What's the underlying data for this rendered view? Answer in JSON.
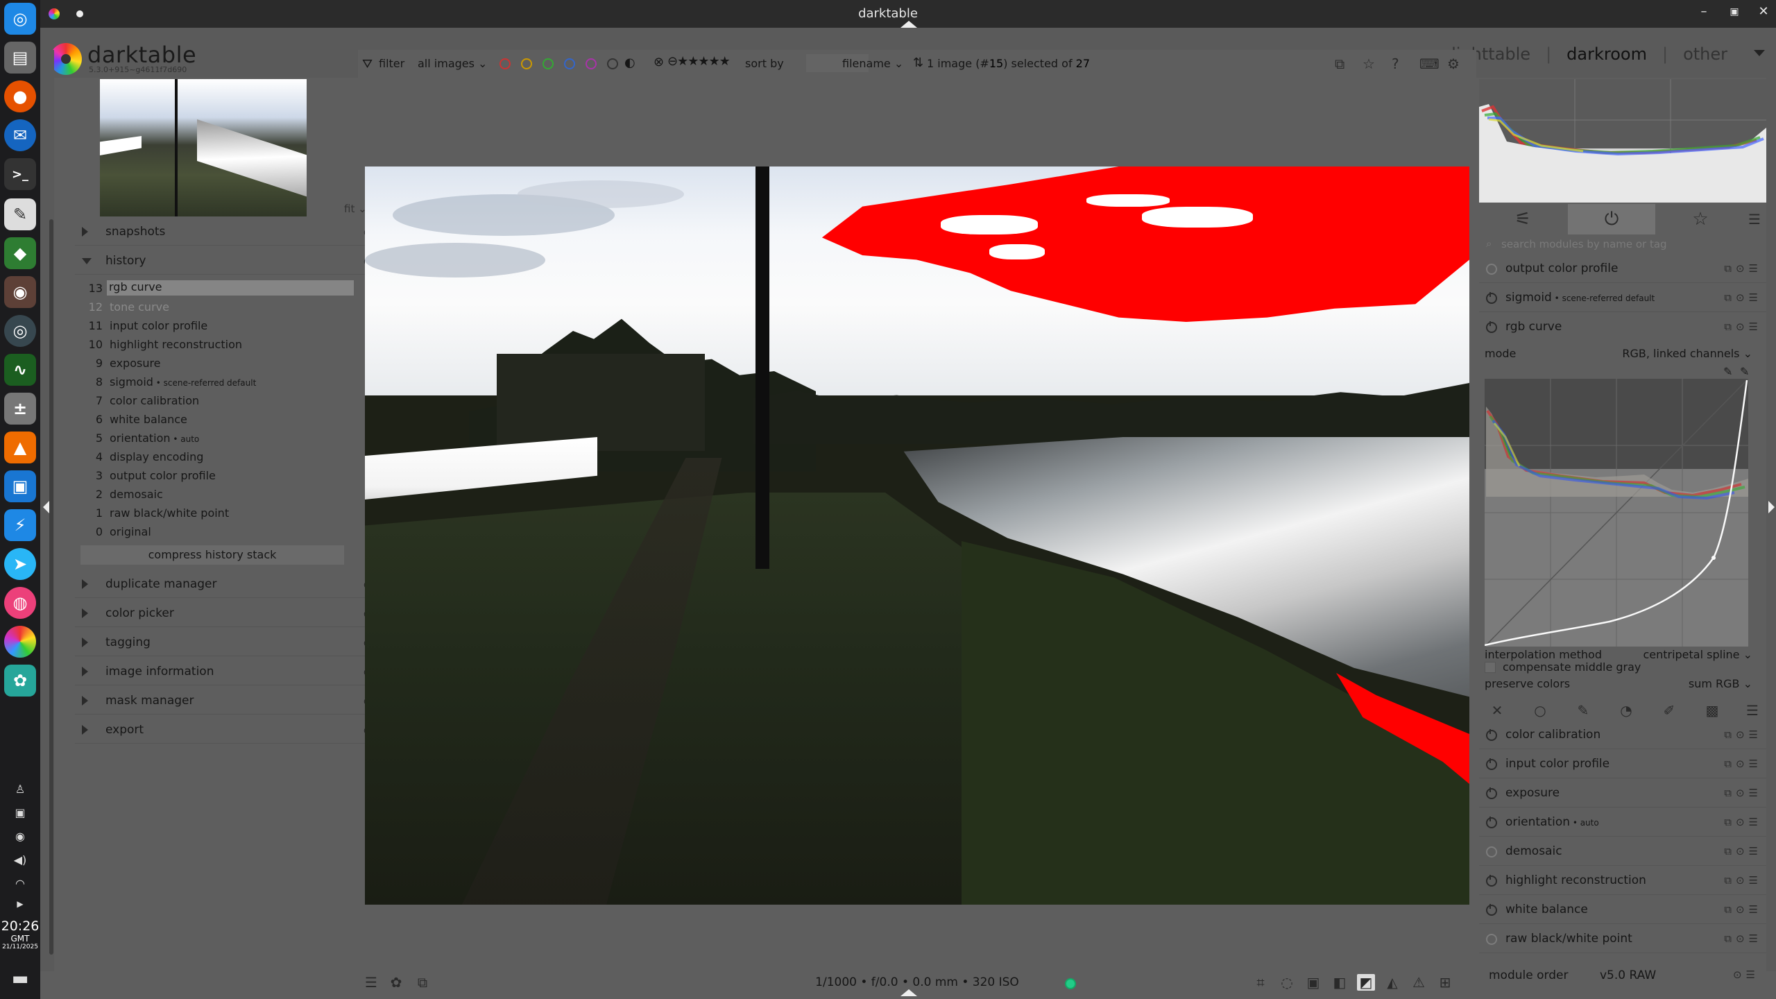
{
  "window": {
    "title": "darktable"
  },
  "header": {
    "brand": "darktable",
    "version": "5.3.0+915~g4611f7d690",
    "views": [
      "lighttable",
      "darkroom",
      "other"
    ],
    "active_view": "darkroom",
    "separator": "|"
  },
  "left": {
    "fit_label": "fit",
    "modules": {
      "snapshots": "snapshots",
      "history": "history",
      "duplicate": "duplicate manager",
      "color_picker": "color picker",
      "tagging": "tagging",
      "image_information": "image information",
      "mask_manager": "mask manager",
      "export": "export"
    },
    "history_items": [
      {
        "num": "13",
        "name": "rgb curve",
        "suffix": ""
      },
      {
        "num": "12",
        "name": "tone curve",
        "suffix": ""
      },
      {
        "num": "11",
        "name": "input color profile",
        "suffix": ""
      },
      {
        "num": "10",
        "name": "highlight reconstruction",
        "suffix": ""
      },
      {
        "num": "9",
        "name": "exposure",
        "suffix": ""
      },
      {
        "num": "8",
        "name": "sigmoid",
        "suffix": " • scene-referred default"
      },
      {
        "num": "7",
        "name": "color calibration",
        "suffix": ""
      },
      {
        "num": "6",
        "name": "white balance",
        "suffix": ""
      },
      {
        "num": "5",
        "name": "orientation",
        "suffix": " • auto"
      },
      {
        "num": "4",
        "name": "display encoding",
        "suffix": ""
      },
      {
        "num": "3",
        "name": "output color profile",
        "suffix": ""
      },
      {
        "num": "2",
        "name": "demosaic",
        "suffix": ""
      },
      {
        "num": "1",
        "name": "raw black/white point",
        "suffix": ""
      },
      {
        "num": "0",
        "name": "original",
        "suffix": ""
      }
    ],
    "compress_label": "compress history stack"
  },
  "filterbar": {
    "filter_label": "filter",
    "filter_value": "all images",
    "sort_label": "sort by",
    "sort_value": "filename",
    "count_prefix": "1 image (#",
    "count_num": "15",
    "count_mid": ") selected of ",
    "count_total": "27",
    "colors": [
      "#c33",
      "#c90",
      "#3a3",
      "#36c",
      "#a3a"
    ]
  },
  "bottom": {
    "exif": "1/1000 • f/0.0 • 0.0 mm • 320 ISO"
  },
  "right": {
    "search_placeholder": "search modules by name or tag",
    "top_modules": [
      {
        "name": "output color profile",
        "suffix": ""
      },
      {
        "name": "sigmoid",
        "suffix": " • scene-referred default"
      },
      {
        "name": "rgb curve",
        "suffix": ""
      }
    ],
    "rgb_curve": {
      "mode_label": "mode",
      "mode_value": "RGB, linked channels",
      "interp_label": "interpolation method",
      "interp_value": "centripetal spline",
      "compensate_label": "compensate middle gray",
      "preserve_label": "preserve colors",
      "preserve_value": "sum RGB"
    },
    "bottom_modules": [
      {
        "name": "color calibration",
        "suffix": ""
      },
      {
        "name": "input color profile",
        "suffix": ""
      },
      {
        "name": "exposure",
        "suffix": ""
      },
      {
        "name": "orientation",
        "suffix": " • auto"
      },
      {
        "name": "demosaic",
        "suffix": ""
      },
      {
        "name": "highlight reconstruction",
        "suffix": ""
      },
      {
        "name": "white balance",
        "suffix": ""
      },
      {
        "name": "raw black/white point",
        "suffix": ""
      }
    ],
    "module_order_label": "module order",
    "module_order_value": "v5.0 RAW"
  },
  "clock": {
    "time": "20:26",
    "tz": "GMT",
    "date": "21/11/2025"
  }
}
